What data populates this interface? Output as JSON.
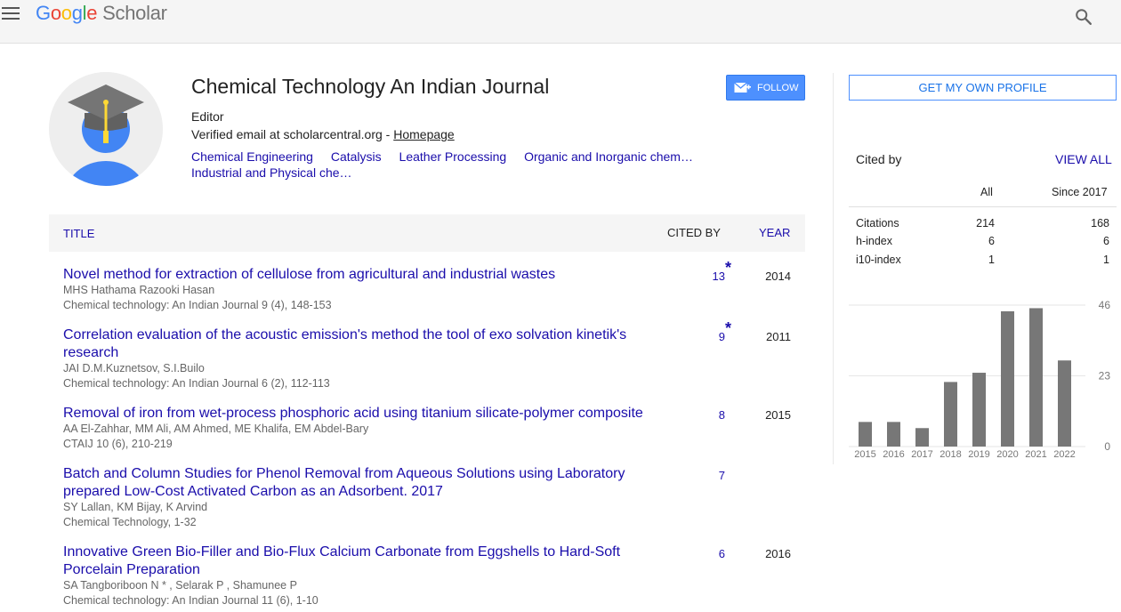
{
  "header": {
    "logo_google": [
      "G",
      "o",
      "o",
      "g",
      "l",
      "e"
    ],
    "logo_scholar": "Scholar"
  },
  "profile": {
    "name": "Chemical Technology An Indian Journal",
    "role": "Editor",
    "email_text": "Verified email at scholarcentral.org - ",
    "homepage_label": "Homepage",
    "interests": [
      "Chemical Engineering",
      "Catalysis",
      "Leather Processing",
      "Organic and Inorganic chem…",
      "Industrial and Physical che…"
    ],
    "follow_label": "FOLLOW"
  },
  "table": {
    "col_title": "TITLE",
    "col_cited": "CITED BY",
    "col_year": "YEAR",
    "rows": [
      {
        "title": "Novel method for extraction of cellulose from agricultural and industrial wastes",
        "authors": "MHS Hathama Razooki Hasan",
        "venue": "Chemical technology: An Indian Journal 9 (4), 148-153",
        "cited": "13",
        "star": "*",
        "year": "2014"
      },
      {
        "title": "Correlation evaluation of the acoustic emission's method the tool of exo solvation kinetik's research",
        "authors": "JAI D.M.Kuznetsov, S.I.Builo",
        "venue": "Chemical technology: An Indian Journal 6 (2), 112-113",
        "cited": "9",
        "star": "*",
        "year": "2011"
      },
      {
        "title": "Removal of iron from wet-process phosphoric acid using titanium silicate-polymer composite",
        "authors": "AA El-Zahhar, MM Ali, AM Ahmed, ME Khalifa, EM Abdel-Bary",
        "venue": "CTAIJ 10 (6), 210-219",
        "cited": "8",
        "star": "",
        "year": "2015"
      },
      {
        "title": "Batch and Column Studies for Phenol Removal from Aqueous Solutions using Laboratory prepared Low-Cost Activated Carbon as an Adsorbent. 2017",
        "authors": "SY Lallan, KM Bijay, K Arvind",
        "venue": "Chemical Technology, 1-32",
        "cited": "7",
        "star": "",
        "year": ""
      },
      {
        "title": "Innovative Green Bio-Filler and Bio-Flux Calcium Carbonate from Eggshells to Hard-Soft Porcelain Preparation",
        "authors": "SA Tangboriboon N * , Selarak P , Shamunee P",
        "venue": "Chemical technology: An Indian Journal 11 (6), 1-10",
        "cited": "6",
        "star": "",
        "year": "2016"
      }
    ]
  },
  "sidebar": {
    "own_profile_label": "GET MY OWN PROFILE",
    "cited_by_label": "Cited by",
    "view_all_label": "VIEW ALL",
    "col_all": "All",
    "col_since": "Since 2017",
    "stats": [
      {
        "label": "Citations",
        "all": "214",
        "since": "168"
      },
      {
        "label": "h-index",
        "all": "6",
        "since": "6"
      },
      {
        "label": "i10-index",
        "all": "1",
        "since": "1"
      }
    ]
  },
  "chart_data": {
    "type": "bar",
    "categories": [
      "2015",
      "2016",
      "2017",
      "2018",
      "2019",
      "2020",
      "2021",
      "2022"
    ],
    "values": [
      8,
      8,
      6,
      21,
      24,
      44,
      45,
      28
    ],
    "ylim": [
      0,
      46
    ],
    "yticks": [
      0,
      23,
      46
    ],
    "grid": true,
    "bar_color": "#777777"
  }
}
